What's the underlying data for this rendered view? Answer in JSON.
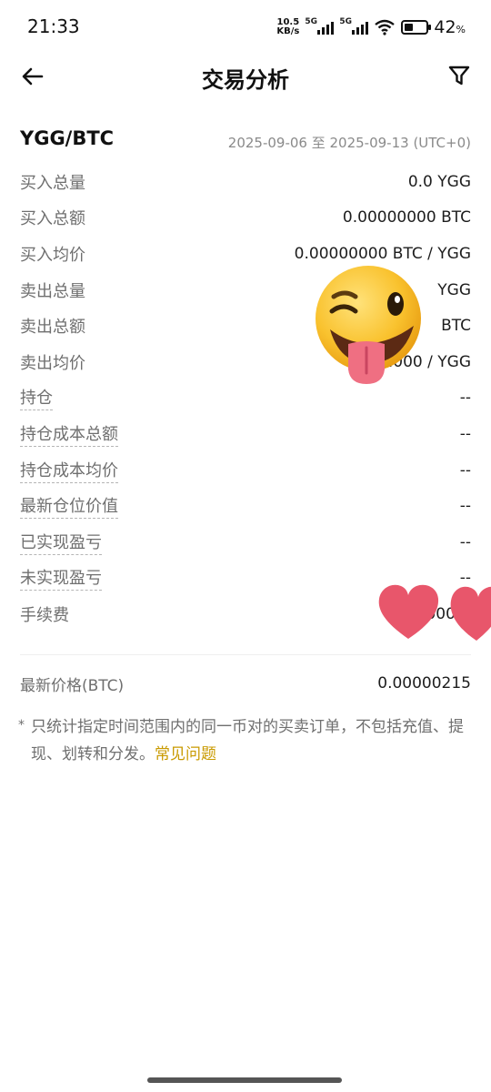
{
  "status_bar": {
    "time": "21:33",
    "net_speed_top": "10.5",
    "net_speed_bottom": "KB/s",
    "sim1": "5G",
    "sim2": "5G",
    "battery_pct": "42",
    "battery_pct_sign": "%"
  },
  "nav": {
    "title": "交易分析",
    "back_icon": "arrow-left-icon",
    "filter_icon": "filter-icon"
  },
  "header": {
    "pair": "YGG/BTC",
    "date_range": "2025-09-06 至 2025-09-13 (UTC+0)"
  },
  "stats": [
    {
      "label": "买入总量",
      "value": "0.0 YGG"
    },
    {
      "label": "买入总额",
      "value": "0.00000000 BTC"
    },
    {
      "label": "买入均价",
      "value": "0.00000000 BTC / YGG"
    },
    {
      "label": "卖出总量",
      "value": "YGG"
    },
    {
      "label": "卖出总额",
      "value": "BTC"
    },
    {
      "label": "卖出均价",
      "value": "0.000 / YGG"
    },
    {
      "label": "持仓",
      "value": "--"
    },
    {
      "label": "持仓成本总额",
      "value": "--"
    },
    {
      "label": "持仓成本均价",
      "value": "--"
    },
    {
      "label": "最新仓位价值",
      "value": "--"
    },
    {
      "label": "已实现盈亏",
      "value": "--"
    },
    {
      "label": "未实现盈亏",
      "value": "--"
    },
    {
      "label": "手续费",
      "value": "0.000 B"
    }
  ],
  "latest_price": {
    "label": "最新价格(BTC)",
    "value": "0.00000215"
  },
  "note": {
    "star": "*",
    "text": "只统计指定时间范围内的同一币对的买卖订单，不包括充值、提现、划转和分发。",
    "link": "常见问题"
  },
  "colors": {
    "link": "#c99a00",
    "label": "#6f6f6f",
    "heart": "#e8566b"
  }
}
